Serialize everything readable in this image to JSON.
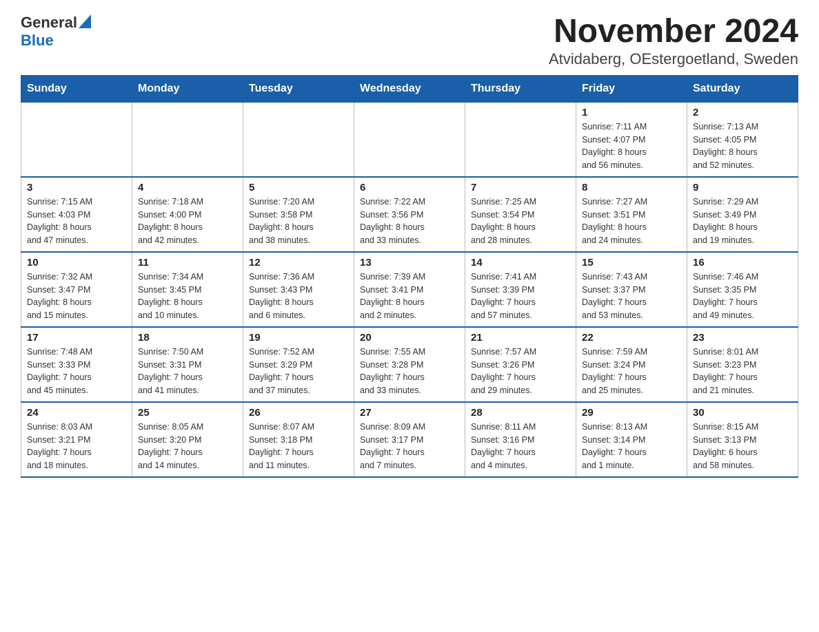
{
  "header": {
    "logo_general": "General",
    "logo_blue": "Blue",
    "title": "November 2024",
    "subtitle": "Atvidaberg, OEstergoetland, Sweden"
  },
  "weekdays": [
    "Sunday",
    "Monday",
    "Tuesday",
    "Wednesday",
    "Thursday",
    "Friday",
    "Saturday"
  ],
  "weeks": [
    [
      {
        "day": "",
        "info": ""
      },
      {
        "day": "",
        "info": ""
      },
      {
        "day": "",
        "info": ""
      },
      {
        "day": "",
        "info": ""
      },
      {
        "day": "",
        "info": ""
      },
      {
        "day": "1",
        "info": "Sunrise: 7:11 AM\nSunset: 4:07 PM\nDaylight: 8 hours\nand 56 minutes."
      },
      {
        "day": "2",
        "info": "Sunrise: 7:13 AM\nSunset: 4:05 PM\nDaylight: 8 hours\nand 52 minutes."
      }
    ],
    [
      {
        "day": "3",
        "info": "Sunrise: 7:15 AM\nSunset: 4:03 PM\nDaylight: 8 hours\nand 47 minutes."
      },
      {
        "day": "4",
        "info": "Sunrise: 7:18 AM\nSunset: 4:00 PM\nDaylight: 8 hours\nand 42 minutes."
      },
      {
        "day": "5",
        "info": "Sunrise: 7:20 AM\nSunset: 3:58 PM\nDaylight: 8 hours\nand 38 minutes."
      },
      {
        "day": "6",
        "info": "Sunrise: 7:22 AM\nSunset: 3:56 PM\nDaylight: 8 hours\nand 33 minutes."
      },
      {
        "day": "7",
        "info": "Sunrise: 7:25 AM\nSunset: 3:54 PM\nDaylight: 8 hours\nand 28 minutes."
      },
      {
        "day": "8",
        "info": "Sunrise: 7:27 AM\nSunset: 3:51 PM\nDaylight: 8 hours\nand 24 minutes."
      },
      {
        "day": "9",
        "info": "Sunrise: 7:29 AM\nSunset: 3:49 PM\nDaylight: 8 hours\nand 19 minutes."
      }
    ],
    [
      {
        "day": "10",
        "info": "Sunrise: 7:32 AM\nSunset: 3:47 PM\nDaylight: 8 hours\nand 15 minutes."
      },
      {
        "day": "11",
        "info": "Sunrise: 7:34 AM\nSunset: 3:45 PM\nDaylight: 8 hours\nand 10 minutes."
      },
      {
        "day": "12",
        "info": "Sunrise: 7:36 AM\nSunset: 3:43 PM\nDaylight: 8 hours\nand 6 minutes."
      },
      {
        "day": "13",
        "info": "Sunrise: 7:39 AM\nSunset: 3:41 PM\nDaylight: 8 hours\nand 2 minutes."
      },
      {
        "day": "14",
        "info": "Sunrise: 7:41 AM\nSunset: 3:39 PM\nDaylight: 7 hours\nand 57 minutes."
      },
      {
        "day": "15",
        "info": "Sunrise: 7:43 AM\nSunset: 3:37 PM\nDaylight: 7 hours\nand 53 minutes."
      },
      {
        "day": "16",
        "info": "Sunrise: 7:46 AM\nSunset: 3:35 PM\nDaylight: 7 hours\nand 49 minutes."
      }
    ],
    [
      {
        "day": "17",
        "info": "Sunrise: 7:48 AM\nSunset: 3:33 PM\nDaylight: 7 hours\nand 45 minutes."
      },
      {
        "day": "18",
        "info": "Sunrise: 7:50 AM\nSunset: 3:31 PM\nDaylight: 7 hours\nand 41 minutes."
      },
      {
        "day": "19",
        "info": "Sunrise: 7:52 AM\nSunset: 3:29 PM\nDaylight: 7 hours\nand 37 minutes."
      },
      {
        "day": "20",
        "info": "Sunrise: 7:55 AM\nSunset: 3:28 PM\nDaylight: 7 hours\nand 33 minutes."
      },
      {
        "day": "21",
        "info": "Sunrise: 7:57 AM\nSunset: 3:26 PM\nDaylight: 7 hours\nand 29 minutes."
      },
      {
        "day": "22",
        "info": "Sunrise: 7:59 AM\nSunset: 3:24 PM\nDaylight: 7 hours\nand 25 minutes."
      },
      {
        "day": "23",
        "info": "Sunrise: 8:01 AM\nSunset: 3:23 PM\nDaylight: 7 hours\nand 21 minutes."
      }
    ],
    [
      {
        "day": "24",
        "info": "Sunrise: 8:03 AM\nSunset: 3:21 PM\nDaylight: 7 hours\nand 18 minutes."
      },
      {
        "day": "25",
        "info": "Sunrise: 8:05 AM\nSunset: 3:20 PM\nDaylight: 7 hours\nand 14 minutes."
      },
      {
        "day": "26",
        "info": "Sunrise: 8:07 AM\nSunset: 3:18 PM\nDaylight: 7 hours\nand 11 minutes."
      },
      {
        "day": "27",
        "info": "Sunrise: 8:09 AM\nSunset: 3:17 PM\nDaylight: 7 hours\nand 7 minutes."
      },
      {
        "day": "28",
        "info": "Sunrise: 8:11 AM\nSunset: 3:16 PM\nDaylight: 7 hours\nand 4 minutes."
      },
      {
        "day": "29",
        "info": "Sunrise: 8:13 AM\nSunset: 3:14 PM\nDaylight: 7 hours\nand 1 minute."
      },
      {
        "day": "30",
        "info": "Sunrise: 8:15 AM\nSunset: 3:13 PM\nDaylight: 6 hours\nand 58 minutes."
      }
    ]
  ]
}
